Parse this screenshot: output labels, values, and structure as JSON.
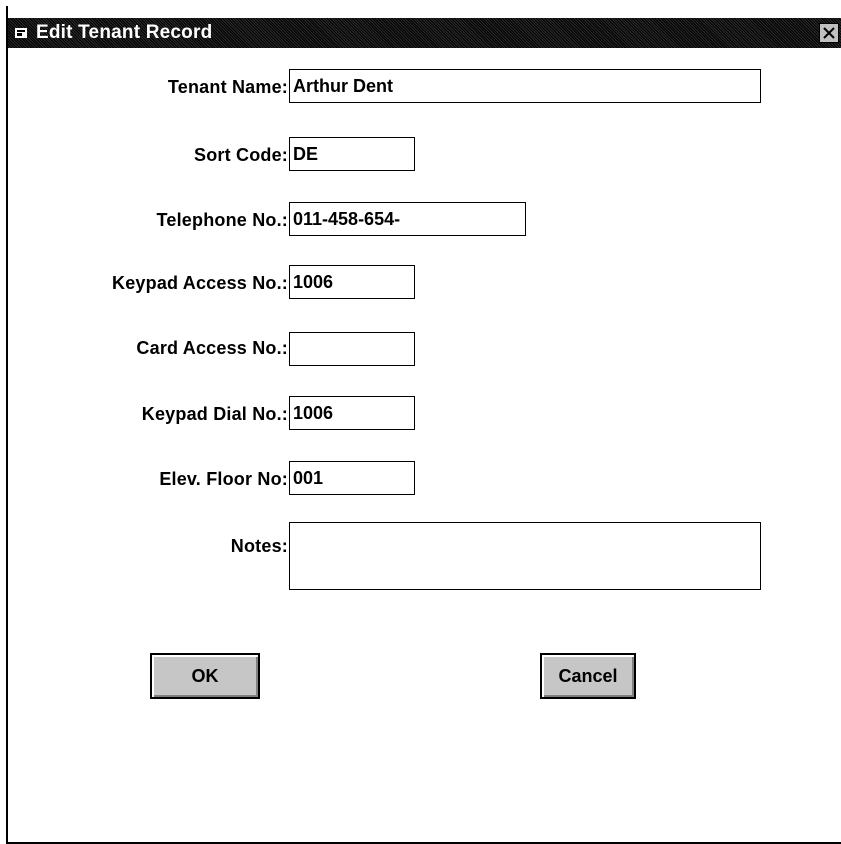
{
  "window": {
    "title": "Edit Tenant Record",
    "close_glyph": "✕"
  },
  "form": {
    "fields": [
      {
        "label": "Tenant Name:",
        "value": "Arthur Dent"
      },
      {
        "label": "Sort Code:",
        "value": "DE"
      },
      {
        "label": "Telephone No.:",
        "value": "011-458-654-"
      },
      {
        "label": "Keypad Access No.:",
        "value": "1006"
      },
      {
        "label": "Card Access No.:",
        "value": ""
      },
      {
        "label": "Keypad Dial No.:",
        "value": "1006"
      },
      {
        "label": "Elev. Floor No:",
        "value": "001"
      },
      {
        "label": "Notes:",
        "value": ""
      }
    ]
  },
  "buttons": {
    "ok": "OK",
    "cancel": "Cancel"
  }
}
